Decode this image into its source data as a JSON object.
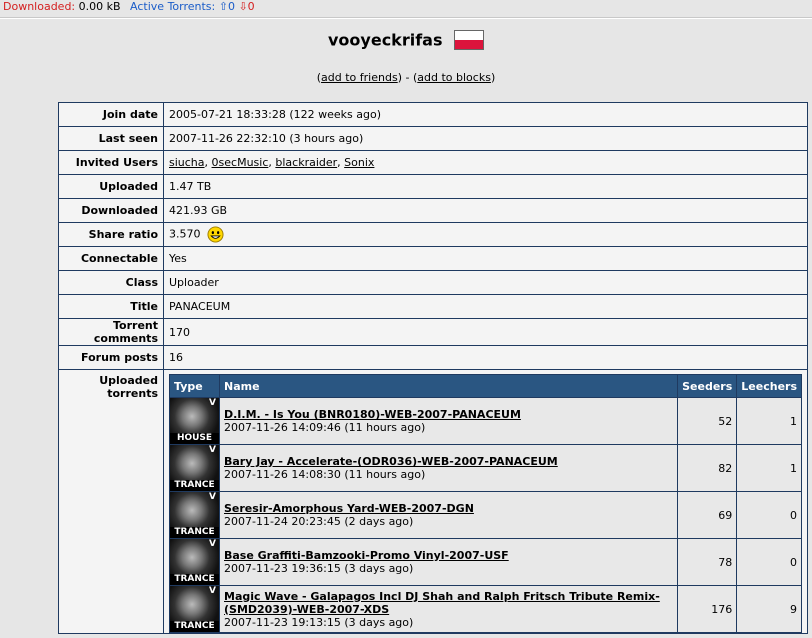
{
  "topbar": {
    "downloaded_label": "Downloaded:",
    "downloaded_value": "0.00 kB",
    "active_label": "Active Torrents:",
    "active_up": "⇧0",
    "active_down": "⇩0"
  },
  "profile": {
    "username": "vooyeckrifas",
    "flag": "poland-flag",
    "add_friends": "add to friends",
    "add_blocks": "add to blocks",
    "paren_open": "(",
    "paren_close": ")",
    "separator": " - "
  },
  "info": {
    "join_date_label": "Join date",
    "join_date": "2005-07-21 18:33:28 (122 weeks ago)",
    "last_seen_label": "Last seen",
    "last_seen": "2007-11-26 22:32:10 (3 hours ago)",
    "invited_label": "Invited Users",
    "invited": [
      "siucha",
      "0secMusic",
      "blackraider",
      "Sonix"
    ],
    "uploaded_label": "Uploaded",
    "uploaded": "1.47 TB",
    "downloaded_label": "Downloaded",
    "downloaded": "421.93 GB",
    "ratio_label": "Share ratio",
    "ratio": "3.570",
    "connectable_label": "Connectable",
    "connectable": "Yes",
    "class_label": "Class",
    "class": "Uploader",
    "title_label": "Title",
    "title": "PANACEUM",
    "comments_label": "Torrent comments",
    "comments": "170",
    "forum_label": "Forum posts",
    "forum": "16",
    "uploaded_torrents_label": "Uploaded torrents"
  },
  "torrents": {
    "headers": {
      "type": "Type",
      "name": "Name",
      "seeders": "Seeders",
      "leechers": "Leechers"
    },
    "rows": [
      {
        "cat": "HOUSE",
        "name": "D.I.M. - Is You (BNR0180)-WEB-2007-PANACEUM",
        "date": "2007-11-26 14:09:46 (11 hours ago)",
        "seeders": "52",
        "leechers": "1"
      },
      {
        "cat": "TRANCE",
        "name": "Bary Jay - Accelerate-(ODR036)-WEB-2007-PANACEUM",
        "date": "2007-11-26 14:08:30 (11 hours ago)",
        "seeders": "82",
        "leechers": "1"
      },
      {
        "cat": "TRANCE",
        "name": "Seresir-Amorphous Yard-WEB-2007-DGN",
        "date": "2007-11-24 20:23:45 (2 days ago)",
        "seeders": "69",
        "leechers": "0"
      },
      {
        "cat": "TRANCE",
        "name": "Base Graffiti-Bamzooki-Promo Vinyl-2007-USF",
        "date": "2007-11-23 19:36:15 (3 days ago)",
        "seeders": "78",
        "leechers": "0"
      },
      {
        "cat": "TRANCE",
        "name": "Magic Wave - Galapagos Incl DJ Shah and Ralph Fritsch Tribute Remix-(SMD2039)-WEB-2007-XDS",
        "date": "2007-11-23 19:13:15 (3 days ago)",
        "seeders": "176",
        "leechers": "9"
      }
    ]
  }
}
